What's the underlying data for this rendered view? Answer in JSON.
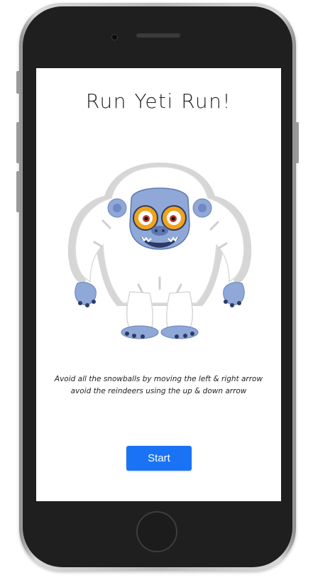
{
  "game": {
    "title": "Run Yeti Run!",
    "instructions": [
      "Avoid all the snowballs by moving the left & right arrow",
      "avoid the reindeers using the up & down arrow"
    ],
    "start_label": "Start"
  },
  "colors": {
    "start_button": "#1a73f5",
    "yeti_fur": "#ffffff",
    "yeti_shade": "#d5d5d5",
    "yeti_skin": "#8fa8d8",
    "yeti_eye": "#f0a31c"
  },
  "icons": {
    "character": "yeti-illustration"
  }
}
